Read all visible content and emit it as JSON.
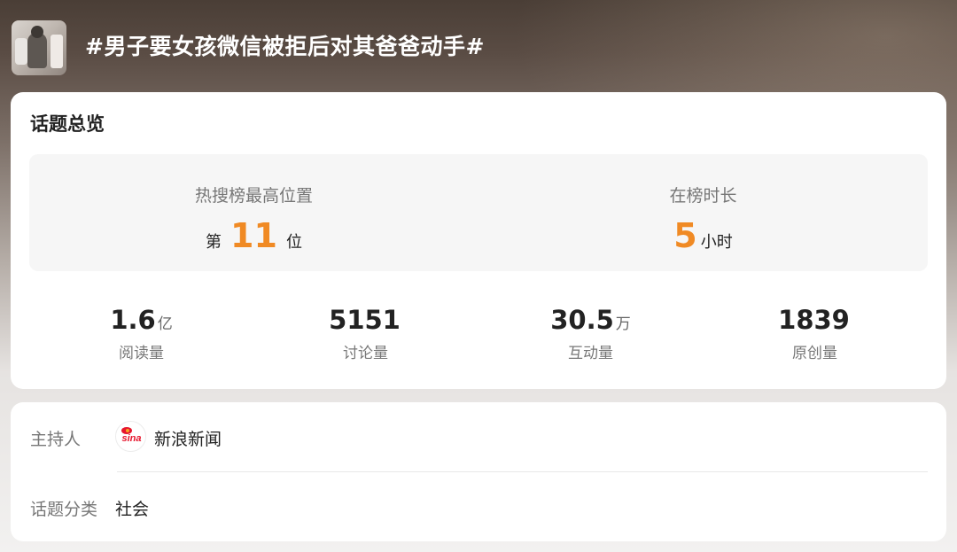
{
  "topic": {
    "title": "#男子要女孩微信被拒后对其爸爸动手#",
    "thumbnail_icon": "topic-photo"
  },
  "overview": {
    "section_title": "话题总览",
    "hot_rank": {
      "label": "热搜榜最高位置",
      "prefix": "第",
      "value": "11",
      "suffix": "位"
    },
    "on_list_duration": {
      "label": "在榜时长",
      "value": "5",
      "unit": "小时"
    },
    "stats": [
      {
        "value": "1.6",
        "unit": "亿",
        "label": "阅读量"
      },
      {
        "value": "5151",
        "unit": "",
        "label": "讨论量"
      },
      {
        "value": "30.5",
        "unit": "万",
        "label": "互动量"
      },
      {
        "value": "1839",
        "unit": "",
        "label": "原创量"
      }
    ]
  },
  "info": {
    "host": {
      "label": "主持人",
      "logo_text": "sina",
      "value": "新浪新闻"
    },
    "category": {
      "label": "话题分类",
      "value": "社会"
    }
  },
  "colors": {
    "accent": "#f08a24",
    "card_bg": "#ffffff",
    "rank_box_bg": "#f6f6f6",
    "sina_red": "#e6162d"
  }
}
